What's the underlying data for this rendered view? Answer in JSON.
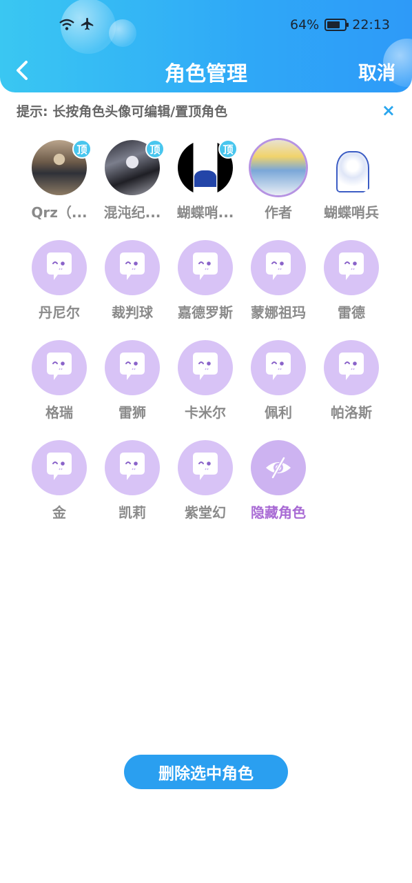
{
  "status_bar": {
    "battery": "64%",
    "time": "22:13",
    "icons": [
      "wifi-icon",
      "airplane-icon",
      "battery-icon"
    ]
  },
  "header": {
    "title": "角色管理",
    "back_icon": "chevron-left-icon",
    "cancel_label": "取消"
  },
  "hint": {
    "text": "提示: 长按角色头像可编辑/置顶角色",
    "close_label": "×"
  },
  "characters": [
    {
      "name": "Qrz（...",
      "pinned": true,
      "pin_label": "顶"
    },
    {
      "name": "混沌纪...",
      "pinned": true,
      "pin_label": "顶"
    },
    {
      "name": "蝴蝶哨...",
      "pinned": true,
      "pin_label": "顶"
    },
    {
      "name": "作者",
      "selected": true
    },
    {
      "name": "蝴蝶哨兵"
    },
    {
      "name": "丹尼尔"
    },
    {
      "name": "裁判球"
    },
    {
      "name": "嘉德罗斯"
    },
    {
      "name": "蒙娜祖玛"
    },
    {
      "name": "雷德"
    },
    {
      "name": "格瑞"
    },
    {
      "name": "雷狮"
    },
    {
      "name": "卡米尔"
    },
    {
      "name": "佩利"
    },
    {
      "name": "帕洛斯"
    },
    {
      "name": "金"
    },
    {
      "name": "凯莉"
    },
    {
      "name": "紫堂幻"
    }
  ],
  "hidden_roles": {
    "label": "隐藏角色",
    "icon": "eye-off-icon"
  },
  "delete_button": {
    "label": "删除选中角色"
  },
  "colors": {
    "header_start": "#3ac7f2",
    "header_end": "#2e9af8",
    "placeholder": "#d8c3f6",
    "accent_purple": "#a86ad4",
    "button_blue": "#2a9ff0",
    "pin_badge": "#48c6ee"
  }
}
